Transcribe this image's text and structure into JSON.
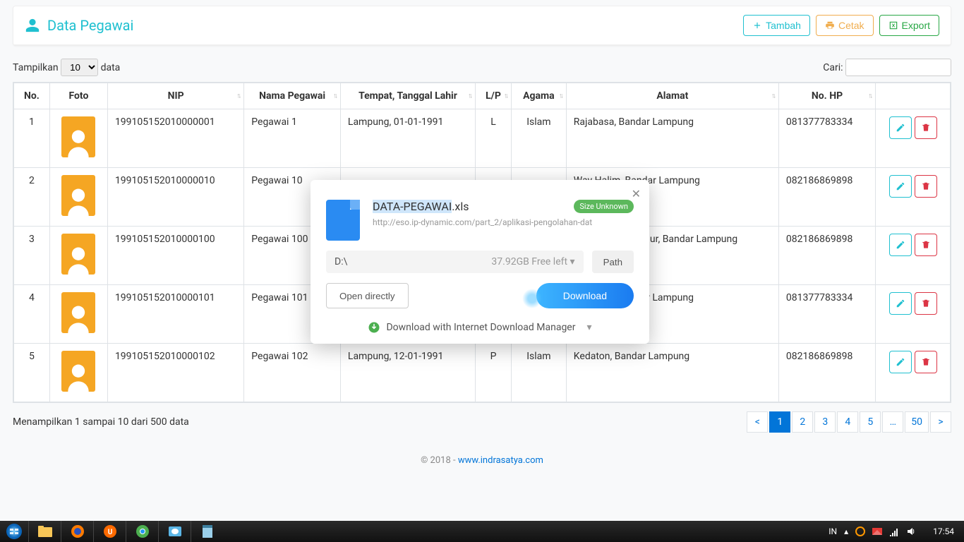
{
  "page": {
    "title": "Data Pegawai",
    "buttons": {
      "add": "Tambah",
      "print": "Cetak",
      "export": "Export"
    },
    "show_prefix": "Tampilkan",
    "show_count": "10",
    "show_suffix": "data",
    "search_label": "Cari:",
    "columns": [
      "No.",
      "Foto",
      "NIP",
      "Nama Pegawai",
      "Tempat, Tanggal Lahir",
      "L/P",
      "Agama",
      "Alamat",
      "No. HP",
      ""
    ],
    "rows": [
      {
        "no": "1",
        "nip": "199105152010000001",
        "nama": "Pegawai 1",
        "ttl": "Lampung, 01-01-1991",
        "lp": "L",
        "agama": "Islam",
        "alamat": "Rajabasa, Bandar Lampung",
        "hp": "081377783334"
      },
      {
        "no": "2",
        "nip": "199105152010000010",
        "nama": "Pegawai 10",
        "ttl": "",
        "lp": "",
        "agama": "",
        "alamat": "Way Halim, Bandar Lampung",
        "hp": "082186869898"
      },
      {
        "no": "3",
        "nip": "199105152010000100",
        "nama": "Pegawai 100",
        "ttl": "",
        "lp": "",
        "agama": "",
        "alamat": "Teluk Betung Timur, Bandar Lampung",
        "hp": "082186869898"
      },
      {
        "no": "4",
        "nip": "199105152010000101",
        "nama": "Pegawai 101",
        "ttl": "",
        "lp": "",
        "agama": "",
        "alamat": "Rajabasa, Bandar Lampung",
        "hp": "081377783334"
      },
      {
        "no": "5",
        "nip": "199105152010000102",
        "nama": "Pegawai 102",
        "ttl": "Lampung, 12-01-1991",
        "lp": "P",
        "agama": "Islam",
        "alamat": "Kedaton, Bandar Lampung",
        "hp": "082186869898"
      }
    ],
    "info": "Menampilkan 1 sampai 10 dari 500 data",
    "pagination": {
      "prev": "<",
      "pages": [
        "1",
        "2",
        "3",
        "4",
        "5",
        "…",
        "50"
      ],
      "next": ">",
      "active": "1"
    },
    "copyright_prefix": "© 2018 - ",
    "copyright_link": "www.indrasatya.com"
  },
  "dialog": {
    "filename_base": "DATA-PEGAWAI",
    "filename_ext": ".xls",
    "size_badge": "Size Unknown",
    "url": "http://eso.ip-dynamic.com/part_2/aplikasi-pengolahan-dat",
    "drive": "D:\\",
    "free": "37.92GB Free left ▾",
    "path_btn": "Path",
    "open_btn": "Open directly",
    "download_btn": "Download",
    "idm_text": "Download with Internet Download Manager"
  },
  "taskbar": {
    "lang": "IN",
    "time": "17:54"
  }
}
